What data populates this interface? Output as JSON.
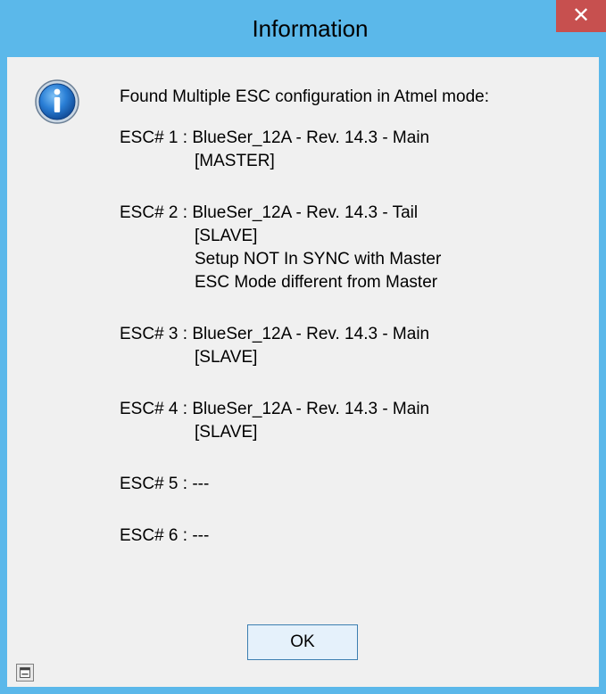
{
  "window": {
    "title": "Information",
    "close_label": "✕"
  },
  "message": {
    "header": "Found Multiple ESC configuration in Atmel mode:",
    "escs": [
      {
        "line": "ESC# 1 : BlueSer_12A - Rev. 14.3 - Main",
        "details": [
          "[MASTER]"
        ]
      },
      {
        "line": "ESC# 2 : BlueSer_12A - Rev. 14.3 - Tail",
        "details": [
          "[SLAVE]",
          "Setup NOT In SYNC with Master",
          "ESC Mode different from Master"
        ]
      },
      {
        "line": "ESC# 3 : BlueSer_12A - Rev. 14.3 - Main",
        "details": [
          "[SLAVE]"
        ]
      },
      {
        "line": "ESC# 4 : BlueSer_12A - Rev. 14.3 - Main",
        "details": [
          "[SLAVE]"
        ]
      },
      {
        "line": "ESC# 5 :  ---",
        "details": []
      },
      {
        "line": "ESC# 6 :  ---",
        "details": []
      }
    ]
  },
  "buttons": {
    "ok_label": "OK"
  },
  "icons": {
    "main": "info-icon",
    "corner": "window-restore-icon"
  },
  "colors": {
    "titlebar": "#5bb8ea",
    "close_button": "#c7504f",
    "dialog_background": "#f0f0f0",
    "info_icon_blue": "#1f6fc5"
  }
}
